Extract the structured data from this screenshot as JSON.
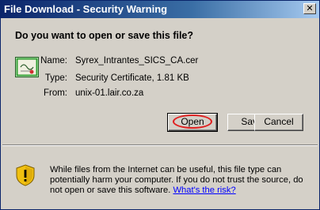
{
  "window": {
    "title": "File Download - Security Warning",
    "close_glyph": "✕"
  },
  "dialog": {
    "question": "Do you want to open or save this file?",
    "file_icon": "certificate-icon",
    "fields": {
      "name_label": "Name:",
      "name_value": "Syrex_Intrantes_SICS_CA.cer",
      "type_label": "Type:",
      "type_value": "Security Certificate, 1.81 KB",
      "from_label": "From:",
      "from_value": "unix-01.lair.co.za"
    },
    "buttons": {
      "open": "Open",
      "save": "Save",
      "cancel": "Cancel"
    },
    "warning": {
      "icon": "shield-warning-icon",
      "text": "While files from the Internet can be useful, this file type can potentially harm your computer. If you do not trust the source, do not open or save this software.",
      "link": "What's the risk?"
    }
  },
  "colors": {
    "titlebar_start": "#0a246a",
    "titlebar_end": "#a6caf0",
    "dialog_bg": "#d4d0c8",
    "highlight": "#e02020",
    "link": "#0000ff"
  }
}
